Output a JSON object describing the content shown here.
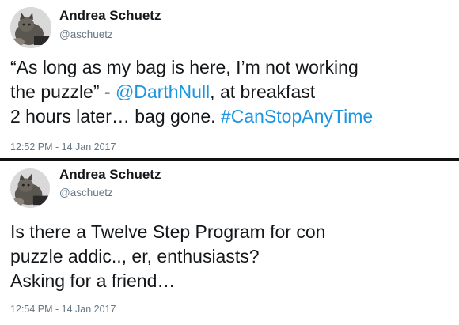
{
  "tweets": [
    {
      "author": {
        "name": "Andrea Schuetz",
        "handle": "@aschuetz",
        "avatar": "cat-avatar"
      },
      "text": {
        "line1": "“As long as my bag is here, I’m not working",
        "line2_a": "the puzzle” - ",
        "line2_mention": "@DarthNull",
        "line2_b": ", at breakfast",
        "line3_a": "2 hours later… bag gone. ",
        "line3_hashtag": "#CanStopAnyTime"
      },
      "timestamp": "12:52 PM - 14 Jan 2017"
    },
    {
      "author": {
        "name": "Andrea Schuetz",
        "handle": "@aschuetz",
        "avatar": "cat-avatar"
      },
      "text": {
        "line1": "Is there a Twelve Step Program for con",
        "line2": "puzzle addic.., er, enthusiasts?",
        "line3": "Asking for a friend…"
      },
      "timestamp": "12:54 PM - 14 Jan 2017"
    }
  ],
  "colors": {
    "link": "#1b95e0",
    "text": "#14171a",
    "muted": "#657786",
    "divider": "#111111"
  }
}
